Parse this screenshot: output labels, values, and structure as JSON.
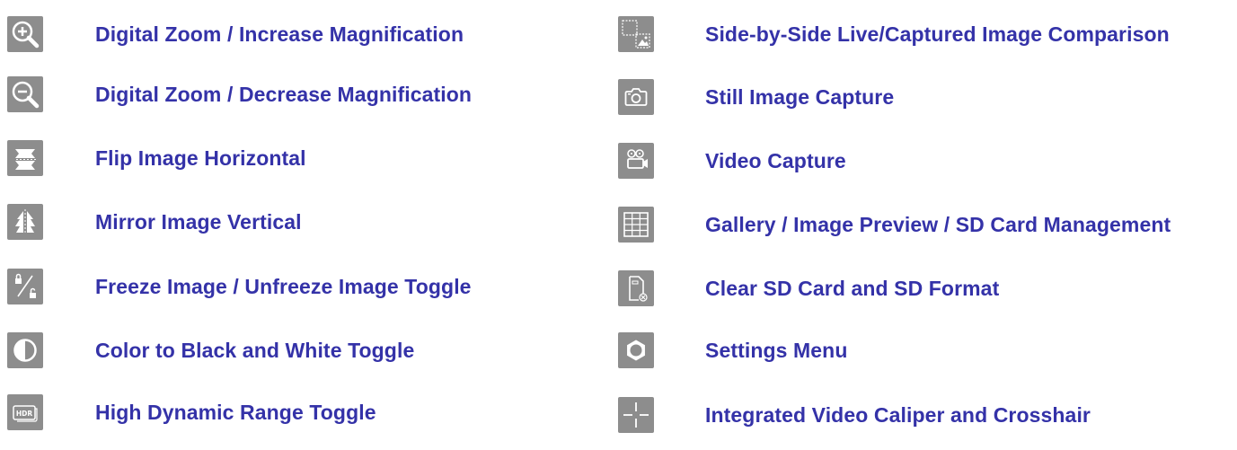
{
  "colors": {
    "icon_background": "#8d8d8d",
    "icon_foreground": "#ffffff",
    "label_text": "#3432a8"
  },
  "left_column": [
    {
      "icon": "zoom-in-icon",
      "label": "Digital Zoom / Increase Magnification"
    },
    {
      "icon": "zoom-out-icon",
      "label": "Digital Zoom / Decrease Magnification"
    },
    {
      "icon": "flip-horizontal-icon",
      "label": "Flip Image Horizontal"
    },
    {
      "icon": "mirror-vertical-icon",
      "label": "Mirror Image Vertical"
    },
    {
      "icon": "freeze-toggle-icon",
      "label": "Freeze Image / Unfreeze Image Toggle"
    },
    {
      "icon": "contrast-icon",
      "label": "Color to Black and White Toggle"
    },
    {
      "icon": "hdr-icon",
      "label": "High Dynamic Range Toggle"
    }
  ],
  "right_column": [
    {
      "icon": "compare-images-icon",
      "label": "Side-by-Side Live/Captured Image Comparison"
    },
    {
      "icon": "camera-icon",
      "label": "Still Image Capture"
    },
    {
      "icon": "video-camera-icon",
      "label": "Video Capture"
    },
    {
      "icon": "gallery-grid-icon",
      "label": "Gallery / Image Preview / SD Card Management"
    },
    {
      "icon": "sd-card-clear-icon",
      "label": "Clear SD Card and SD Format"
    },
    {
      "icon": "gear-icon",
      "label": "Settings Menu"
    },
    {
      "icon": "crosshair-icon",
      "label": "Integrated Video Caliper and Crosshair"
    }
  ]
}
